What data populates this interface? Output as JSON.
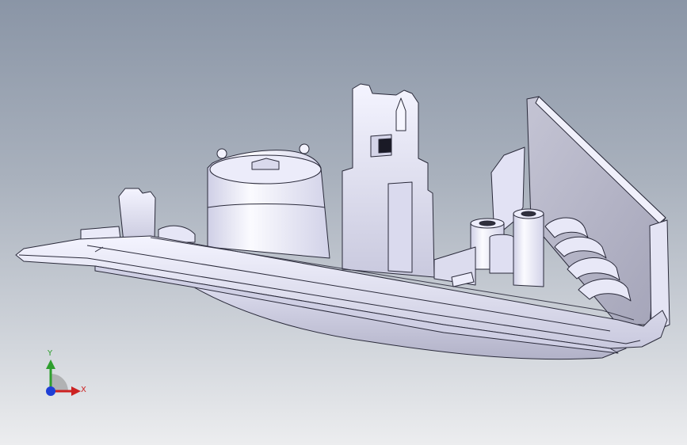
{
  "viewport": {
    "background_top": "#8a95a6",
    "background_bottom": "#ecedef",
    "part_color": "#e6e6f6",
    "part_shadow": "#b6b6ca",
    "edge_color": "#2a2a3a"
  },
  "triad": {
    "x_label": "X",
    "y_label": "Y",
    "x_color": "#cc2222",
    "y_color": "#2e9e2e",
    "z_color": "#1f3fd6"
  }
}
